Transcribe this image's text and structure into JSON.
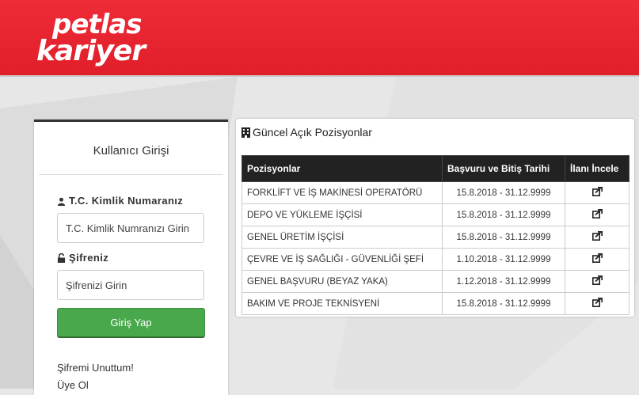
{
  "brand": {
    "line1": "petlas",
    "line2": "kariyer"
  },
  "login": {
    "title": "Kullanıcı Girişi",
    "tc_label": "T.C. Kimlik Numaranız",
    "tc_placeholder": "T.C. Kimlik Numranızı Girin",
    "password_label": "Şifreniz",
    "password_placeholder": "Şifrenizi Girin",
    "submit_label": "Giriş Yap",
    "forgot_label": "Şifremi Unuttum!",
    "register_label": "Üye Ol"
  },
  "positions": {
    "title": "Güncel Açık Pozisyonlar",
    "columns": [
      "Pozisyonlar",
      "Başvuru ve Bitiş Tarihi",
      "İlanı İncele"
    ],
    "rows": [
      {
        "name": "FORKLİFT VE İŞ MAKİNESİ OPERATÖRÜ",
        "dates": "15.8.2018 - 31.12.9999"
      },
      {
        "name": "DEPO VE YÜKLEME İŞÇİSİ",
        "dates": "15.8.2018 - 31.12.9999"
      },
      {
        "name": "GENEL ÜRETİM İŞÇİSİ",
        "dates": "15.8.2018 - 31.12.9999"
      },
      {
        "name": "ÇEVRE VE İŞ SAĞLIĞI - GÜVENLİĞİ ŞEFİ",
        "dates": "1.10.2018 - 31.12.9999"
      },
      {
        "name": "GENEL BAŞVURU (BEYAZ YAKA)",
        "dates": "1.12.2018 - 31.12.9999"
      },
      {
        "name": "BAKIM VE PROJE TEKNİSYENİ",
        "dates": "15.8.2018 - 31.12.9999"
      }
    ]
  },
  "colors": {
    "header": "#e8222e",
    "button": "#49a84c",
    "table_header": "#222222"
  }
}
